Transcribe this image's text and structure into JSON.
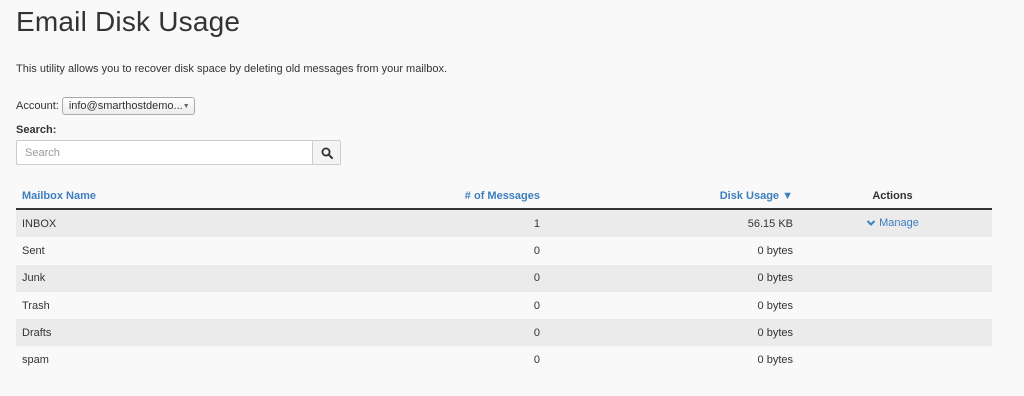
{
  "page": {
    "title": "Email Disk Usage",
    "description": "This utility allows you to recover disk space by deleting old messages from your mailbox."
  },
  "account": {
    "label": "Account:",
    "selected": "info@smarthostdemo..."
  },
  "search": {
    "label": "Search:",
    "placeholder": "Search",
    "value": ""
  },
  "table": {
    "columns": {
      "name": "Mailbox Name",
      "messages": "# of Messages",
      "usage": "Disk Usage ▼",
      "actions": "Actions"
    },
    "rows": [
      {
        "name": "INBOX",
        "messages": "1",
        "usage": "56.15 KB",
        "action": "Manage"
      },
      {
        "name": "Sent",
        "messages": "0",
        "usage": "0 bytes",
        "action": ""
      },
      {
        "name": "Junk",
        "messages": "0",
        "usage": "0 bytes",
        "action": ""
      },
      {
        "name": "Trash",
        "messages": "0",
        "usage": "0 bytes",
        "action": ""
      },
      {
        "name": "Drafts",
        "messages": "0",
        "usage": "0 bytes",
        "action": ""
      },
      {
        "name": "spam",
        "messages": "0",
        "usage": "0 bytes",
        "action": ""
      }
    ]
  },
  "colors": {
    "link": "#3d7ebf",
    "row_stripe": "#ebebeb",
    "background": "#f9f9f9"
  },
  "icons": {
    "search_button": "search-icon",
    "select_caret": "caret-down-icon",
    "manage": "chevron-down-icon"
  }
}
